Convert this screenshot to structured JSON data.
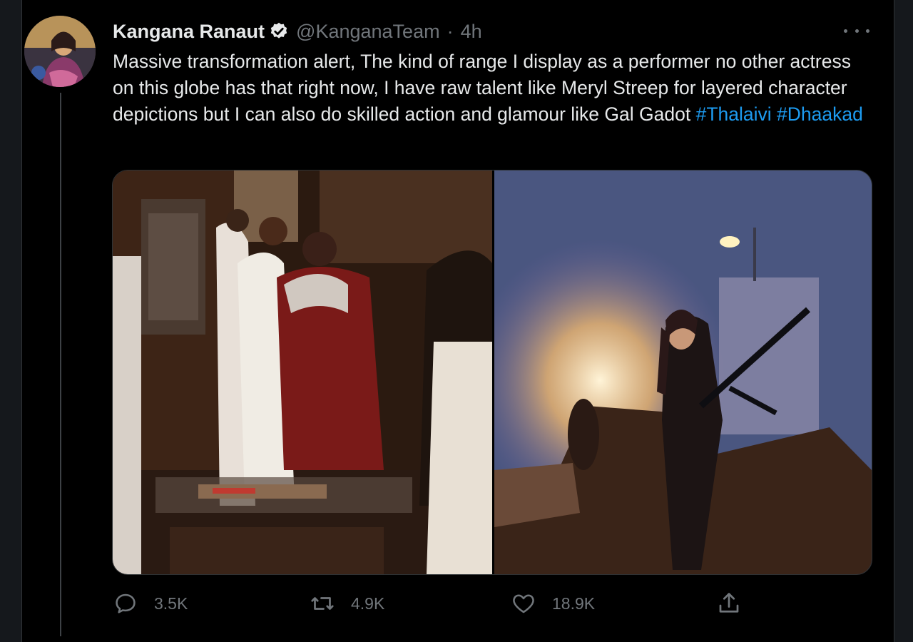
{
  "tweet": {
    "author_name": "Kangana Ranaut",
    "handle": "@KanganaTeam",
    "separator": "·",
    "time": "4h",
    "text_main": "Massive transformation alert, The kind of range I display as a performer no other actress on this globe has that right now, I have raw talent like Meryl Streep for layered character depictions but I can also do skilled action and glamour like Gal Gadot",
    "hashtags": [
      "#Thalaivi",
      "#Dhaakad"
    ],
    "verified_icon": "verified-badge-icon",
    "more_icon": "more-options-icon"
  },
  "media": {
    "photos": [
      {
        "icon": "photo-thalaivi"
      },
      {
        "icon": "photo-dhaakad"
      }
    ]
  },
  "actions": {
    "reply": {
      "icon": "reply-icon",
      "count": "3.5K"
    },
    "retweet": {
      "icon": "retweet-icon",
      "count": "4.9K"
    },
    "like": {
      "icon": "heart-icon",
      "count": "18.9K"
    },
    "share": {
      "icon": "share-icon"
    }
  },
  "colors": {
    "background": "#000000",
    "text": "#e7e9ea",
    "muted": "#71767b",
    "link": "#1d9bf0",
    "border": "#2f3336"
  }
}
